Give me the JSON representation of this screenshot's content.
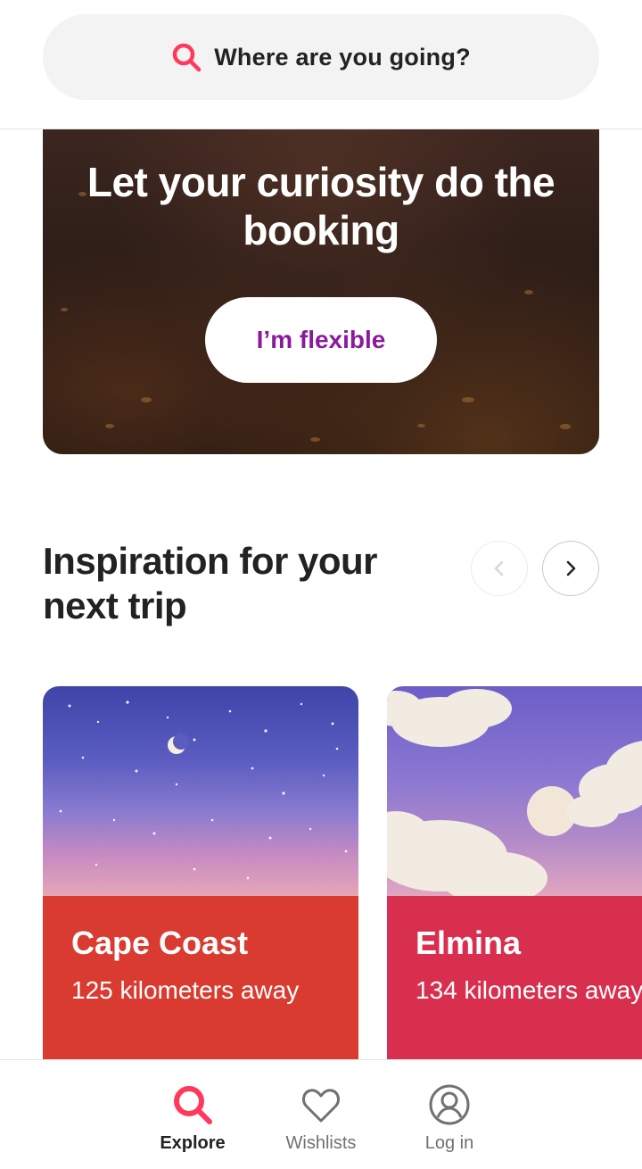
{
  "colors": {
    "brand": "#ff385c",
    "flexible_text": "#8a1a9c",
    "card1_bg": "#d93b30",
    "card2_bg": "#d92f4f"
  },
  "search": {
    "icon": "search-icon",
    "placeholder": "Where are you going?"
  },
  "hero": {
    "title": "Let your curiosity do the booking",
    "button_label": "I’m flexible"
  },
  "inspiration": {
    "title": "Inspiration for your next trip",
    "prev_icon": "chevron-left-icon",
    "next_icon": "chevron-right-icon",
    "cards": [
      {
        "city": "Cape Coast",
        "distance": "125 kilometers away"
      },
      {
        "city": "Elmina",
        "distance": "134 kilometers away"
      }
    ]
  },
  "bottom_nav": {
    "items": [
      {
        "label": "Explore",
        "icon": "search-icon",
        "active": true
      },
      {
        "label": "Wishlists",
        "icon": "heart-icon",
        "active": false
      },
      {
        "label": "Log in",
        "icon": "user-circle-icon",
        "active": false
      }
    ]
  }
}
